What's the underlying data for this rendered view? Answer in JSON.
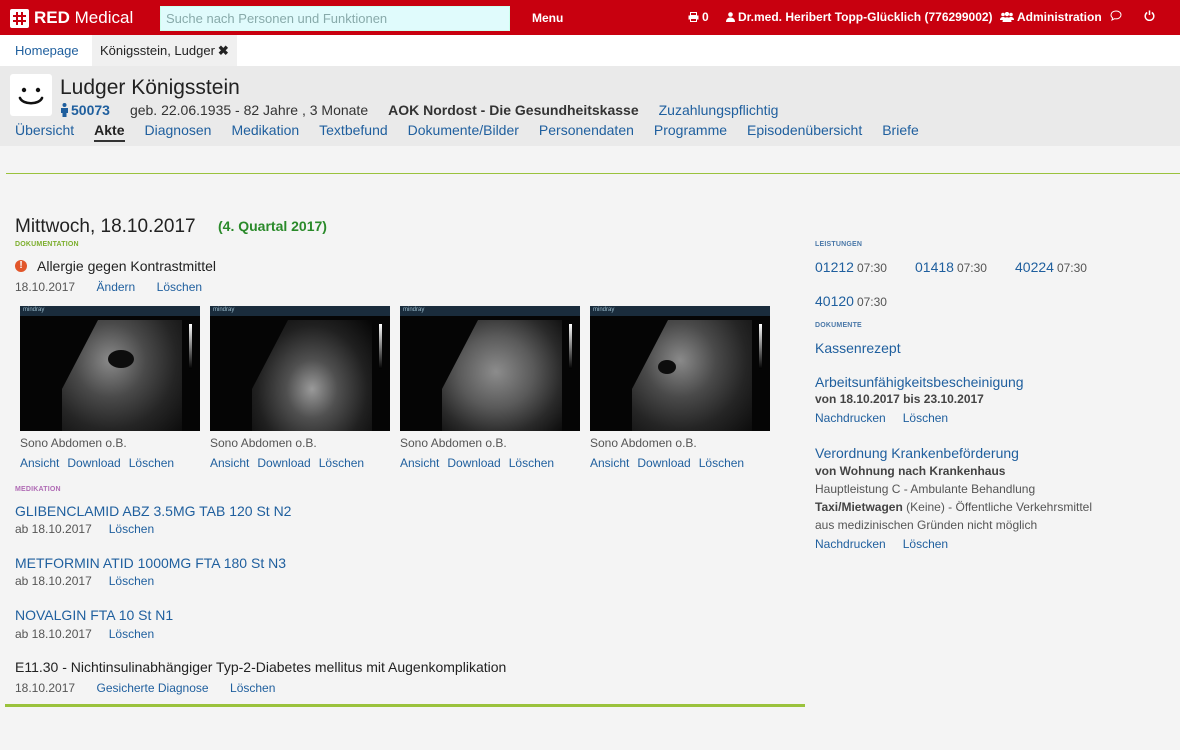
{
  "app": {
    "brand_bold": "RED",
    "brand_rest": "Medical"
  },
  "topbar": {
    "search_placeholder": "Suche nach Personen und Funktionen",
    "menu": "Menu",
    "print_count": "0",
    "user": "Dr.med. Heribert Topp-Glücklich (776299002)",
    "admin": "Administration"
  },
  "tabs": [
    {
      "label": "Homepage"
    },
    {
      "label": "Königsstein, Ludger",
      "close": "✖"
    }
  ],
  "patient": {
    "name": "Ludger Königsstein",
    "id": "50073",
    "birth": "geb. 22.06.1935 - 82 Jahre , 3 Monate",
    "insurance": "AOK Nordost - Die Gesundheitskasse",
    "copay": "Zuzahlungspflichtig"
  },
  "nav": [
    "Übersicht",
    "Akte",
    "Diagnosen",
    "Medikation",
    "Textbefund",
    "Dokumente/Bilder",
    "Personendaten",
    "Programme",
    "Episodenübersicht",
    "Briefe"
  ],
  "entry": {
    "date": "Mittwoch, 18.10.2017",
    "quarter": "(4. Quartal 2017)"
  },
  "documentation": {
    "label": "DOKUMENTATION",
    "allergy": "Allergie gegen Kontrastmittel",
    "allergy_date": "18.10.2017",
    "edit": "Ändern",
    "delete": "Löschen",
    "images": [
      {
        "caption": "Sono Abdomen o.B."
      },
      {
        "caption": "Sono Abdomen o.B."
      },
      {
        "caption": "Sono Abdomen o.B."
      },
      {
        "caption": "Sono Abdomen o.B."
      }
    ],
    "image_brand": "mindray",
    "img_actions": {
      "view": "Ansicht",
      "download": "Download",
      "delete": "Löschen"
    }
  },
  "medication": {
    "label": "MEDIKATION",
    "items": [
      {
        "name": "GLIBENCLAMID ABZ 3.5MG TAB 120 St N2",
        "since": "ab 18.10.2017",
        "delete": "Löschen"
      },
      {
        "name": "METFORMIN ATID 1000MG FTA 180 St N3",
        "since": "ab 18.10.2017",
        "delete": "Löschen"
      },
      {
        "name": "NOVALGIN FTA 10 St N1",
        "since": "ab 18.10.2017",
        "delete": "Löschen"
      }
    ]
  },
  "diagnosis": {
    "text": "E11.30 - Nichtinsulinabhängiger Typ-2-Diabetes mellitus mit Augenkomplikation",
    "date": "18.10.2017",
    "status": "Gesicherte Diagnose",
    "delete": "Löschen"
  },
  "services": {
    "label": "LEISTUNGEN",
    "items": [
      {
        "code": "01212",
        "time": "07:30"
      },
      {
        "code": "01418",
        "time": "07:30"
      },
      {
        "code": "40224",
        "time": "07:30"
      },
      {
        "code": "40120",
        "time": "07:30"
      }
    ]
  },
  "documents": {
    "label": "DOKUMENTE",
    "rezept": "Kassenrezept",
    "au": {
      "title": "Arbeitsunfähigkeitsbescheinigung",
      "from_label": "von",
      "from": "18.10.2017",
      "to_label": "bis",
      "to": "23.10.2017",
      "reprint": "Nachdrucken",
      "delete": "Löschen"
    },
    "transport": {
      "title": "Verordnung Krankenbeförderung",
      "route": "von Wohnung nach Krankenhaus",
      "main": "Hauptleistung C - Ambulante Behandlung",
      "vehicle": "Taxi/Mietwagen",
      "vehicle_rest": "(Keine) - Öffentliche Verkehrsmittel",
      "reason": "aus medizinischen Gründen nicht möglich",
      "reprint": "Nachdrucken",
      "delete": "Löschen"
    }
  },
  "colors": {
    "brand": "#c8000f",
    "accent_green": "#9ac23c",
    "link": "#1f5f9e",
    "quarter": "#2a8a2a",
    "medikation_label": "#b06cb5",
    "doc_label": "#7cae2c",
    "right_label": "#4a78a8"
  }
}
